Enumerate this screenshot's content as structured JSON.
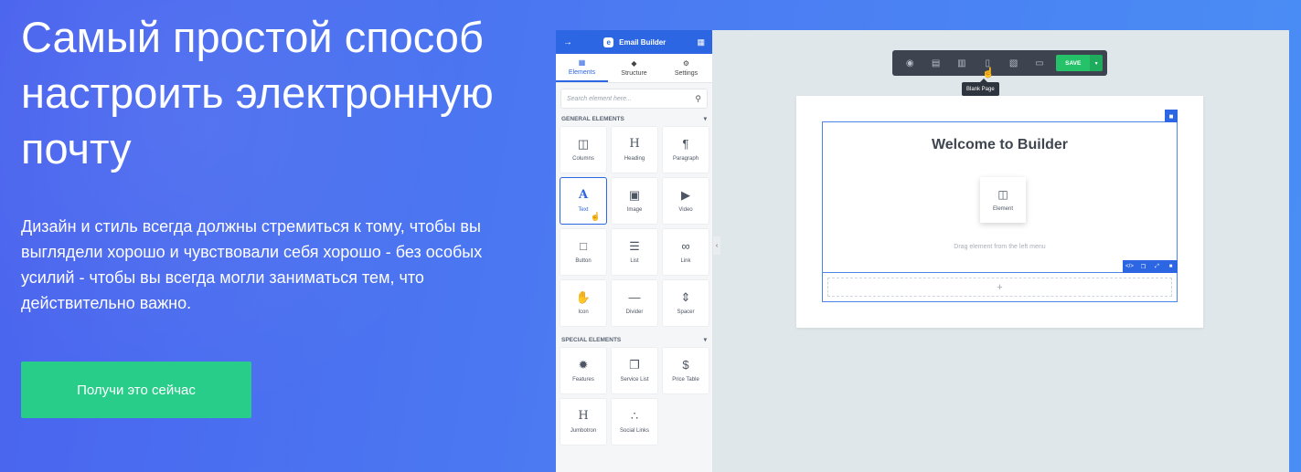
{
  "hero": {
    "title": "Самый простой способ настроить электронную почту",
    "description": "Дизайн и стиль всегда должны стремиться к тому, чтобы вы выглядели хорошо и чувствовали себя хорошо - без особых усилий - чтобы вы всегда могли заниматься тем, что действительно важно.",
    "cta_label": "Получи это сейчас"
  },
  "app": {
    "header_title": "Email Builder",
    "logo_letter": "e",
    "tabs": [
      {
        "label": "Elements",
        "active": true
      },
      {
        "label": "Structure",
        "active": false
      },
      {
        "label": "Settings",
        "active": false
      }
    ],
    "search_placeholder": "Search element here...",
    "general_section_label": "GENERAL ELEMENTS",
    "general_elements": [
      {
        "label": "Columns",
        "icon": "columns-icon"
      },
      {
        "label": "Heading",
        "icon": "heading-icon"
      },
      {
        "label": "Paragraph",
        "icon": "paragraph-icon"
      },
      {
        "label": "Text",
        "icon": "text-icon",
        "active": true
      },
      {
        "label": "Image",
        "icon": "image-icon"
      },
      {
        "label": "Video",
        "icon": "video-icon"
      },
      {
        "label": "Button",
        "icon": "button-icon"
      },
      {
        "label": "List",
        "icon": "list-icon"
      },
      {
        "label": "Link",
        "icon": "link-icon"
      },
      {
        "label": "Icon",
        "icon": "thumbs-up-icon"
      },
      {
        "label": "Divider",
        "icon": "divider-icon"
      },
      {
        "label": "Spacer",
        "icon": "spacer-icon"
      }
    ],
    "special_section_label": "SPECIAL ELEMENTS",
    "special_elements": [
      {
        "label": "Features",
        "icon": "features-icon"
      },
      {
        "label": "Service List",
        "icon": "service-list-icon"
      },
      {
        "label": "Price Table",
        "icon": "dollar-icon"
      },
      {
        "label": "Jumbotron",
        "icon": "jumbotron-icon"
      },
      {
        "label": "Social Links",
        "icon": "share-icon"
      }
    ],
    "toolbar": {
      "save_label": "SAVE",
      "tooltip": "Blank Page"
    },
    "canvas": {
      "heading": "Welcome to Builder",
      "drop_card_label": "Element",
      "drop_hint": "Drag element from the left menu",
      "add_symbol": "+"
    }
  },
  "colors": {
    "accent": "#2c66e3",
    "cta": "#29cd8a",
    "save": "#25c26a",
    "toolbar": "#3d4450"
  }
}
